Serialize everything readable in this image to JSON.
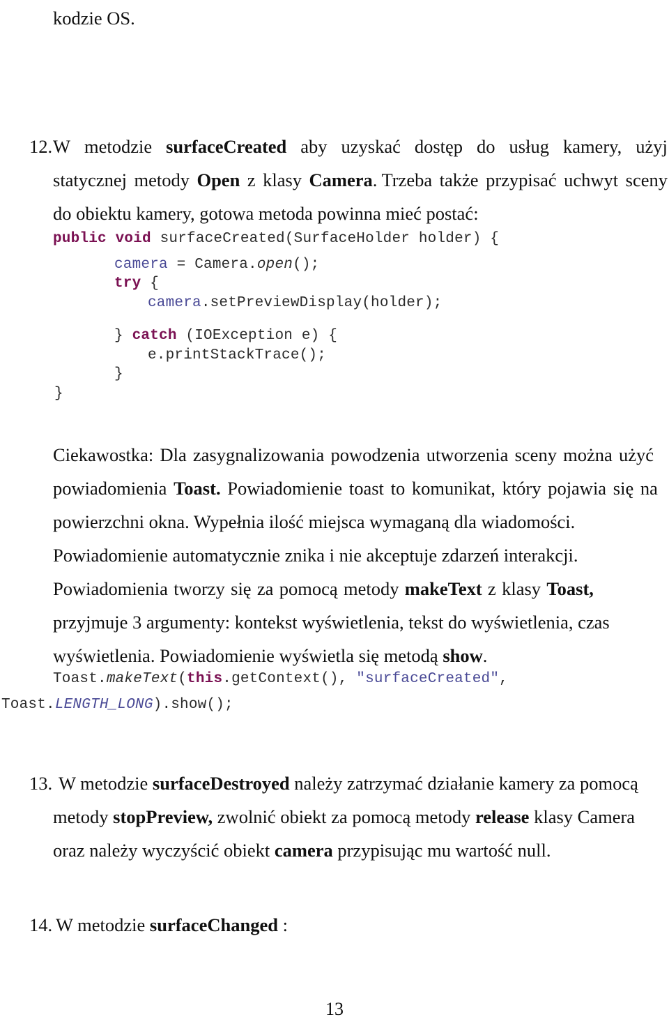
{
  "document": {
    "language": "pl",
    "page_number": "13",
    "top_continuation": "kodzie OS."
  },
  "items": [
    {
      "number": "12.",
      "lines": [
        {
          "segments": [
            {
              "text": "W",
              "bold": false
            },
            {
              "text": "metodzie",
              "bold": false
            },
            {
              "text": "surfaceCreated",
              "bold": true
            },
            {
              "text": "aby",
              "bold": false
            },
            {
              "text": "uzyskać",
              "bold": false
            },
            {
              "text": "dostęp",
              "bold": false
            },
            {
              "text": "do",
              "bold": false
            },
            {
              "text": "usług",
              "bold": false
            },
            {
              "text": "kamery,",
              "bold": false
            },
            {
              "text": "użyj",
              "bold": false
            }
          ]
        },
        {
          "segments": [
            {
              "text": "statycznej",
              "bold": false
            },
            {
              "text": "metody",
              "bold": false
            },
            {
              "text": "Open",
              "bold": true
            },
            {
              "text": "z",
              "bold": false
            },
            {
              "text": "klasy",
              "bold": false
            },
            {
              "text": "Camera",
              "bold": true
            },
            {
              "text": ". Trzeba",
              "bold": false
            },
            {
              "text": "także",
              "bold": false
            },
            {
              "text": "przypisać",
              "bold": false
            },
            {
              "text": "uchwyt",
              "bold": false
            },
            {
              "text": "sceny",
              "bold": false
            }
          ]
        }
      ],
      "last_line": "do obiektu kamery, gotowa metoda powinna mieć postać:"
    }
  ],
  "code_block_1": {
    "lines": [
      {
        "indent": 0,
        "tokens": [
          {
            "text": "public void ",
            "style": "kw"
          },
          {
            "text": "surfaceCreated(SurfaceHolder holder) {",
            "style": "plain"
          }
        ]
      },
      {
        "indent": 4,
        "tokens": [
          {
            "text": "camera",
            "style": "var"
          },
          {
            "text": " = Camera.",
            "style": "plain"
          },
          {
            "text": "open",
            "style": "ital"
          },
          {
            "text": "();",
            "style": "plain"
          }
        ]
      },
      {
        "indent": 4,
        "tokens": [
          {
            "text": "try",
            "style": "kw"
          },
          {
            "text": " {",
            "style": "plain"
          }
        ]
      },
      {
        "indent": 6,
        "tokens": [
          {
            "text": "camera",
            "style": "var"
          },
          {
            "text": ".setPreviewDisplay(holder);",
            "style": "plain"
          }
        ]
      },
      {
        "indent": 0,
        "tokens": [
          {
            "text": "",
            "style": "plain"
          }
        ]
      },
      {
        "indent": 4,
        "tokens": [
          {
            "text": "} ",
            "style": "plain"
          },
          {
            "text": "catch",
            "style": "kw"
          },
          {
            "text": " (IOException e) {",
            "style": "plain"
          }
        ]
      },
      {
        "indent": 6,
        "tokens": [
          {
            "text": "e.printStackTrace();",
            "style": "plain"
          }
        ]
      },
      {
        "indent": 4,
        "tokens": [
          {
            "text": "}",
            "style": "plain"
          }
        ]
      },
      {
        "indent": 1,
        "tokens": [
          {
            "text": "}",
            "style": "plain"
          }
        ]
      }
    ]
  },
  "paragraph_toast": {
    "lines": [
      {
        "segments": [
          {
            "text": "Ciekawostka:",
            "bold": false
          },
          {
            "text": "Dla",
            "bold": false
          },
          {
            "text": "zasygnalizowania",
            "bold": false
          },
          {
            "text": "powodzenia",
            "bold": false
          },
          {
            "text": "utworzenia",
            "bold": false
          },
          {
            "text": "sceny",
            "bold": false
          },
          {
            "text": "można",
            "bold": false
          },
          {
            "text": "użyć",
            "bold": false
          }
        ]
      },
      {
        "segments": [
          {
            "text": "powiadomienia",
            "bold": false
          },
          {
            "text": "Toast.",
            "bold": true
          },
          {
            "text": "Powiadomienie",
            "bold": false
          },
          {
            "text": "toast",
            "bold": false
          },
          {
            "text": "to",
            "bold": false
          },
          {
            "text": "komunikat,",
            "bold": false
          },
          {
            "text": "który",
            "bold": false
          },
          {
            "text": "pojawia",
            "bold": false
          },
          {
            "text": "się",
            "bold": false
          },
          {
            "text": "na",
            "bold": false
          }
        ]
      },
      {
        "plain": "powierzchni okna. Wypełnia ilość miejsca wymaganą dla wiadomości."
      },
      {
        "plain": "Powiadomienie automatycznie znika i nie akceptuje zdarzeń interakcji."
      },
      {
        "segments": [
          {
            "text": "Powiadomienia",
            "bold": false
          },
          {
            "text": "tworzy",
            "bold": false
          },
          {
            "text": "się",
            "bold": false
          },
          {
            "text": "za",
            "bold": false
          },
          {
            "text": "pomocą",
            "bold": false
          },
          {
            "text": "metody",
            "bold": false
          },
          {
            "text": "makeText",
            "bold": true
          },
          {
            "text": "z",
            "bold": false
          },
          {
            "text": "klasy",
            "bold": false
          },
          {
            "text": "Toast,",
            "bold": true
          }
        ]
      },
      {
        "plain": "przyjmuje 3 argumenty: kontekst wyświetlenia, tekst do wyświetlenia, czas"
      },
      {
        "segments_tail": [
          {
            "text": "wyświetlenia. Powiadomienie wyświetla się metodą ",
            "bold": false
          },
          {
            "text": "show",
            "bold": true
          },
          {
            "text": ".",
            "bold": false
          }
        ]
      }
    ]
  },
  "code_block_2": {
    "lines": [
      {
        "indent": 3,
        "tokens": [
          {
            "text": "Toast.",
            "style": "plain"
          },
          {
            "text": "makeText",
            "style": "ital"
          },
          {
            "text": "(",
            "style": "plain"
          },
          {
            "text": "this",
            "style": "kw"
          },
          {
            "text": ".getContext(), ",
            "style": "plain"
          },
          {
            "text": "\"surfaceCreated\"",
            "style": "str"
          },
          {
            "text": ",",
            "style": "plain"
          }
        ]
      },
      {
        "indent": 0,
        "tokens": [
          {
            "text": "Toast.",
            "style": "plain"
          },
          {
            "text": "LENGTH_LONG",
            "style": "strital"
          },
          {
            "text": ").show();",
            "style": "plain"
          }
        ]
      }
    ]
  },
  "item_13": {
    "number": "13.",
    "lines": [
      {
        "segments": [
          {
            "text": "W metodzie ",
            "bold": false
          },
          {
            "text": "surfaceDestroyed",
            "bold": true
          },
          {
            "text": " należy zatrzymać działanie kamery za pomocą",
            "bold": false
          }
        ]
      },
      {
        "segments": [
          {
            "text": "metody ",
            "bold": false
          },
          {
            "text": "stopPreview,",
            "bold": true
          },
          {
            "text": " zwolnić obiekt za pomocą metody ",
            "bold": false
          },
          {
            "text": "release",
            "bold": true
          },
          {
            "text": " klasy Camera",
            "bold": false
          }
        ]
      },
      {
        "segments": [
          {
            "text": "oraz należy wyczyścić obiekt ",
            "bold": false
          },
          {
            "text": "camera",
            "bold": true
          },
          {
            "text": " przypisując mu wartość null.",
            "bold": false
          }
        ]
      }
    ]
  },
  "item_14": {
    "number": "14.",
    "segments": [
      {
        "text": "W metodzie ",
        "bold": false
      },
      {
        "text": "surfaceChanged",
        "bold": true
      },
      {
        "text": " :",
        "bold": false
      }
    ]
  },
  "colors": {
    "text": "#101010",
    "code_keyword": "#7a1052",
    "code_identifier": "#4a4a96",
    "code_plain": "#2b2b2b",
    "background": "#ffffff"
  }
}
